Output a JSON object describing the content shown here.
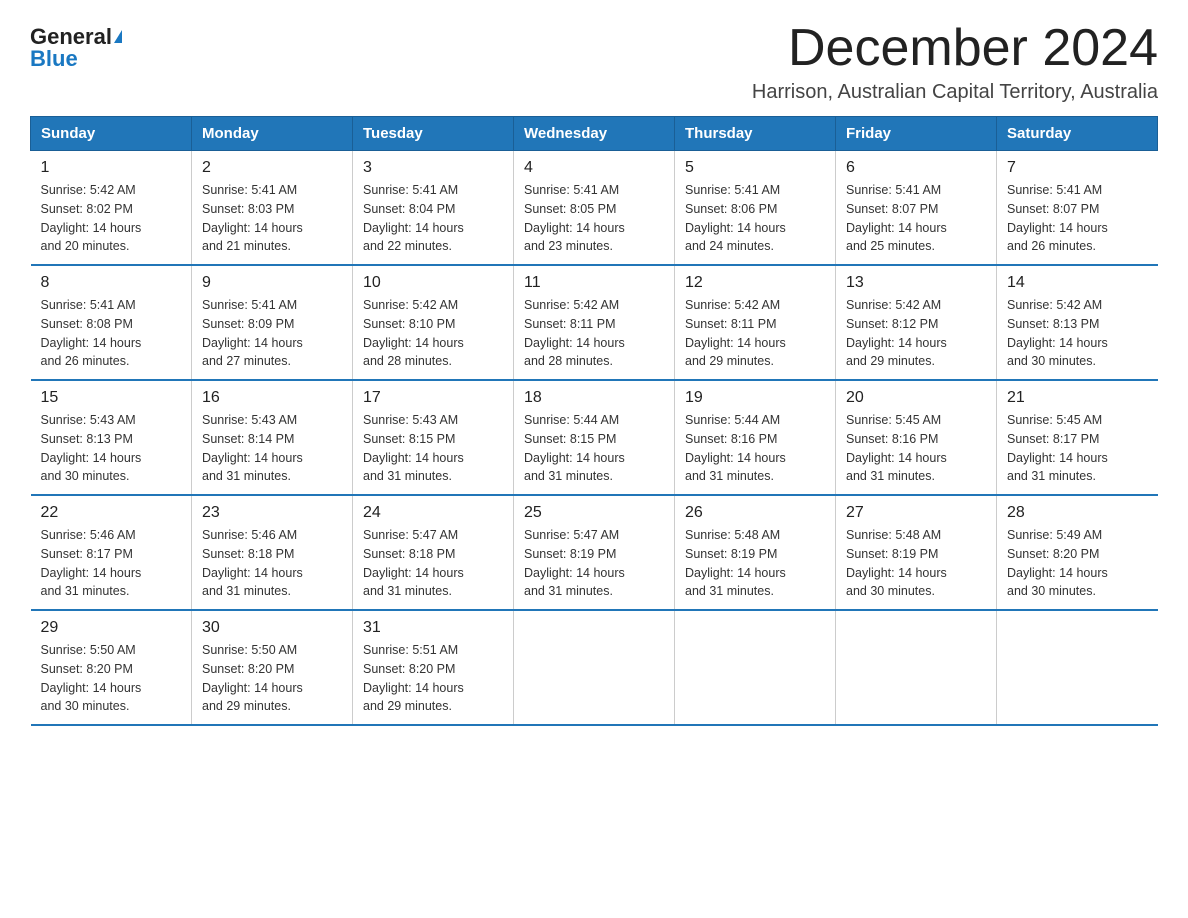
{
  "logo": {
    "general": "General",
    "blue": "Blue"
  },
  "title": "December 2024",
  "location": "Harrison, Australian Capital Territory, Australia",
  "days_of_week": [
    "Sunday",
    "Monday",
    "Tuesday",
    "Wednesday",
    "Thursday",
    "Friday",
    "Saturday"
  ],
  "weeks": [
    [
      {
        "day": "1",
        "sunrise": "5:42 AM",
        "sunset": "8:02 PM",
        "daylight": "14 hours and 20 minutes."
      },
      {
        "day": "2",
        "sunrise": "5:41 AM",
        "sunset": "8:03 PM",
        "daylight": "14 hours and 21 minutes."
      },
      {
        "day": "3",
        "sunrise": "5:41 AM",
        "sunset": "8:04 PM",
        "daylight": "14 hours and 22 minutes."
      },
      {
        "day": "4",
        "sunrise": "5:41 AM",
        "sunset": "8:05 PM",
        "daylight": "14 hours and 23 minutes."
      },
      {
        "day": "5",
        "sunrise": "5:41 AM",
        "sunset": "8:06 PM",
        "daylight": "14 hours and 24 minutes."
      },
      {
        "day": "6",
        "sunrise": "5:41 AM",
        "sunset": "8:07 PM",
        "daylight": "14 hours and 25 minutes."
      },
      {
        "day": "7",
        "sunrise": "5:41 AM",
        "sunset": "8:07 PM",
        "daylight": "14 hours and 26 minutes."
      }
    ],
    [
      {
        "day": "8",
        "sunrise": "5:41 AM",
        "sunset": "8:08 PM",
        "daylight": "14 hours and 26 minutes."
      },
      {
        "day": "9",
        "sunrise": "5:41 AM",
        "sunset": "8:09 PM",
        "daylight": "14 hours and 27 minutes."
      },
      {
        "day": "10",
        "sunrise": "5:42 AM",
        "sunset": "8:10 PM",
        "daylight": "14 hours and 28 minutes."
      },
      {
        "day": "11",
        "sunrise": "5:42 AM",
        "sunset": "8:11 PM",
        "daylight": "14 hours and 28 minutes."
      },
      {
        "day": "12",
        "sunrise": "5:42 AM",
        "sunset": "8:11 PM",
        "daylight": "14 hours and 29 minutes."
      },
      {
        "day": "13",
        "sunrise": "5:42 AM",
        "sunset": "8:12 PM",
        "daylight": "14 hours and 29 minutes."
      },
      {
        "day": "14",
        "sunrise": "5:42 AM",
        "sunset": "8:13 PM",
        "daylight": "14 hours and 30 minutes."
      }
    ],
    [
      {
        "day": "15",
        "sunrise": "5:43 AM",
        "sunset": "8:13 PM",
        "daylight": "14 hours and 30 minutes."
      },
      {
        "day": "16",
        "sunrise": "5:43 AM",
        "sunset": "8:14 PM",
        "daylight": "14 hours and 31 minutes."
      },
      {
        "day": "17",
        "sunrise": "5:43 AM",
        "sunset": "8:15 PM",
        "daylight": "14 hours and 31 minutes."
      },
      {
        "day": "18",
        "sunrise": "5:44 AM",
        "sunset": "8:15 PM",
        "daylight": "14 hours and 31 minutes."
      },
      {
        "day": "19",
        "sunrise": "5:44 AM",
        "sunset": "8:16 PM",
        "daylight": "14 hours and 31 minutes."
      },
      {
        "day": "20",
        "sunrise": "5:45 AM",
        "sunset": "8:16 PM",
        "daylight": "14 hours and 31 minutes."
      },
      {
        "day": "21",
        "sunrise": "5:45 AM",
        "sunset": "8:17 PM",
        "daylight": "14 hours and 31 minutes."
      }
    ],
    [
      {
        "day": "22",
        "sunrise": "5:46 AM",
        "sunset": "8:17 PM",
        "daylight": "14 hours and 31 minutes."
      },
      {
        "day": "23",
        "sunrise": "5:46 AM",
        "sunset": "8:18 PM",
        "daylight": "14 hours and 31 minutes."
      },
      {
        "day": "24",
        "sunrise": "5:47 AM",
        "sunset": "8:18 PM",
        "daylight": "14 hours and 31 minutes."
      },
      {
        "day": "25",
        "sunrise": "5:47 AM",
        "sunset": "8:19 PM",
        "daylight": "14 hours and 31 minutes."
      },
      {
        "day": "26",
        "sunrise": "5:48 AM",
        "sunset": "8:19 PM",
        "daylight": "14 hours and 31 minutes."
      },
      {
        "day": "27",
        "sunrise": "5:48 AM",
        "sunset": "8:19 PM",
        "daylight": "14 hours and 30 minutes."
      },
      {
        "day": "28",
        "sunrise": "5:49 AM",
        "sunset": "8:20 PM",
        "daylight": "14 hours and 30 minutes."
      }
    ],
    [
      {
        "day": "29",
        "sunrise": "5:50 AM",
        "sunset": "8:20 PM",
        "daylight": "14 hours and 30 minutes."
      },
      {
        "day": "30",
        "sunrise": "5:50 AM",
        "sunset": "8:20 PM",
        "daylight": "14 hours and 29 minutes."
      },
      {
        "day": "31",
        "sunrise": "5:51 AM",
        "sunset": "8:20 PM",
        "daylight": "14 hours and 29 minutes."
      },
      null,
      null,
      null,
      null
    ]
  ],
  "labels": {
    "sunrise": "Sunrise:",
    "sunset": "Sunset:",
    "daylight": "Daylight:"
  }
}
